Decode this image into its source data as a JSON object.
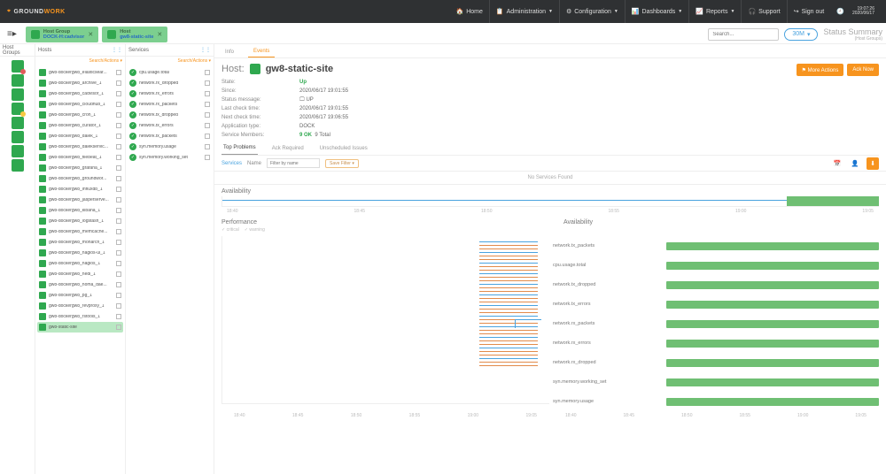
{
  "brand": {
    "left": "GROUND",
    "right": "WORK"
  },
  "topnav": [
    {
      "icon": "🏠",
      "label": "Home"
    },
    {
      "icon": "📋",
      "label": "Administration",
      "caret": true
    },
    {
      "icon": "⚙",
      "label": "Configuration",
      "caret": true
    },
    {
      "icon": "📊",
      "label": "Dashboards",
      "caret": true
    },
    {
      "icon": "📈",
      "label": "Reports",
      "caret": true
    },
    {
      "icon": "🎧",
      "label": "Support"
    },
    {
      "icon": "↪",
      "label": "Sign out"
    }
  ],
  "clock": {
    "time": "19:07:26",
    "date": "2020/06/17"
  },
  "tabs": [
    {
      "kind": "Host Group",
      "value": "DOCK-H:cadvisor"
    },
    {
      "kind": "Host",
      "value": "gw8-static-site"
    }
  ],
  "search_placeholder": "Search...",
  "range_pill": "30M",
  "summary": {
    "title": "Status Summary",
    "sub": "(Host Groups)"
  },
  "cols": {
    "hg": "Host Groups",
    "h": "Hosts",
    "s": "Services",
    "sa": "Search/Actions ▾"
  },
  "hostgroups": [
    {
      "status": "crit"
    },
    {
      "status": "ok"
    },
    {
      "status": "ok"
    },
    {
      "status": "warn"
    },
    {
      "status": "ok"
    },
    {
      "status": "ok"
    },
    {
      "status": "ok"
    },
    {
      "status": "ok"
    }
  ],
  "hosts": [
    "gw8-dockergw8_elasticsear...",
    "gw8-dockergw8_archive_1",
    "gw8-dockergw8_cadvisor_1",
    "gw8-dockergw8_cloudhub_1",
    "gw8-dockergw8_cron_1",
    "gw8-dockergw8_curator_1",
    "gw8-dockergw8_dalek_1",
    "gw8-dockergw8_dalekservic...",
    "gw8-dockergw8_filebeat_1",
    "gw8-dockergw8_grafana_1",
    "gw8-dockergw8_groundwor...",
    "gw8-dockergw8_influxdb_1",
    "gw8-dockergw8_jasperserve...",
    "gw8-dockergw8_kibana_1",
    "gw8-dockergw8_logstash_1",
    "gw8-dockergw8_memcache...",
    "gw8-dockergw8_monarch_1",
    "gw8-dockergw8_nagios-ui_1",
    "gw8-dockergw8_nagios_1",
    "gw8-dockergw8_nedi_1",
    "gw8-dockergw8_noma_dae...",
    "gw8-dockergw8_pg_1",
    "gw8-dockergw8_revproxy_1",
    "gw8-dockergw8_rstools_1",
    "gw8-static-site"
  ],
  "selected_host_index": 24,
  "services": [
    "cpu.usage.total",
    "network.rx_dropped",
    "network.rx_errors",
    "network.rx_packets",
    "network.tx_dropped",
    "network.tx_errors",
    "network.tx_packets",
    "syn.memory.usage",
    "syn.memory.working_set"
  ],
  "main_tabs": {
    "info": "Info",
    "events": "Events"
  },
  "host_header": {
    "label": "Host:",
    "name": "gw8-static-site"
  },
  "buttons": {
    "more": "⚑ More Actions",
    "ack": "Ack Now"
  },
  "meta": [
    {
      "k": "State:",
      "v": "Up",
      "cls": "up"
    },
    {
      "k": "Since:",
      "v": "2020/06/17 19:01:55"
    },
    {
      "k": "Status message:",
      "v": "🖵 UP"
    },
    {
      "k": "Last check time:",
      "v": "2020/06/17 19:01:55"
    },
    {
      "k": "Next check time:",
      "v": "2020/06/17 19:06:55"
    },
    {
      "k": "Application type:",
      "v": "DOCK"
    },
    {
      "k": "Service Members:",
      "v_html": true,
      "ok": "9 OK",
      "total": "9 Total"
    }
  ],
  "prob_tabs": [
    "Top Problems",
    "Ack Required",
    "Unscheduled Issues"
  ],
  "filter": {
    "svc": "Services",
    "name": "Name",
    "ph": "Filter by name",
    "save": "Save Filter ▾"
  },
  "nosvc": "No Services Found",
  "sections": {
    "avail": "Availability",
    "perf": "Performance"
  },
  "legend": [
    "critical",
    "warning"
  ],
  "time_ticks": [
    "18:40",
    "18:45",
    "18:50",
    "18:55",
    "19:00",
    "19:05"
  ],
  "metrics": [
    "network.tx_packets",
    "cpu.usage.total",
    "network.tx_dropped",
    "network.tx_errors",
    "network.rx_packets",
    "network.rx_errors",
    "network.rx_dropped",
    "syn.memory.working_set",
    "syn.memory.usage"
  ],
  "chart_data": {
    "availability": {
      "type": "line",
      "x_range": [
        "18:40",
        "19:05"
      ],
      "state": "Up",
      "uptime_pct": 100
    },
    "performance_left": {
      "type": "line",
      "x_range": [
        "18:40",
        "19:05"
      ],
      "series": [
        "critical",
        "warning"
      ],
      "note": "dense overlapping threshold lines near right edge"
    },
    "availability_bars": {
      "type": "bar",
      "categories": [
        "network.tx_packets",
        "cpu.usage.total",
        "network.tx_dropped",
        "network.tx_errors",
        "network.rx_packets",
        "network.rx_errors",
        "network.rx_dropped",
        "syn.memory.working_set",
        "syn.memory.usage"
      ],
      "values_pct": [
        100,
        100,
        100,
        100,
        100,
        100,
        100,
        100,
        100
      ],
      "x_range": [
        "18:40",
        "19:05"
      ]
    }
  }
}
